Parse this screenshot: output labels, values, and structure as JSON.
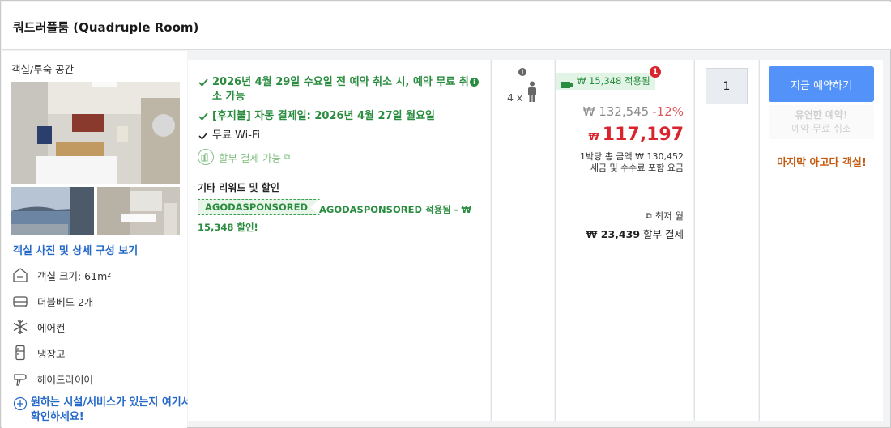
{
  "header": {
    "title": "쿼드러플룸 (Quadruple Room)"
  },
  "left": {
    "section_title": "객실/투숙 공간",
    "view_link": "객실 사진 및 상세 구성 보기",
    "amenities": [
      {
        "icon": "room-size-icon",
        "label": "객실 크기: 61m²"
      },
      {
        "icon": "bed-icon",
        "label": "더블베드 2개"
      },
      {
        "icon": "snowflake-icon",
        "label": "에어컨"
      },
      {
        "icon": "fridge-icon",
        "label": "냉장고"
      },
      {
        "icon": "hairdryer-icon",
        "label": "헤어드라이어"
      }
    ],
    "more_link": "원하는 시설/서비스가 있는지 여기서 확인하세요!"
  },
  "benefits": {
    "cancel": "2026년 4월 29일 수요일 전 예약 취소 시, 예약 무료 취소 가능",
    "postpay": "[후지불] 자동 결제일: 2026년 4월 27일 월요일",
    "wifi": "무료 Wi-Fi",
    "installment": "할부 결제 가능",
    "other_title": "기타 리워드 및 할인",
    "promo_code": "AGODASPONSORED",
    "promo_text": "AGODASPONSORED 적용됨 - ₩ 15,348 할인!"
  },
  "occupancy": {
    "count": "4 x"
  },
  "price": {
    "savings": "₩ 15,348 적용됨",
    "badge": "1",
    "original": "₩ 132,545",
    "discount": "-12%",
    "currency": "₩",
    "amount": "117,197",
    "total_line1": "1박당 총 금액 ₩ 130,452",
    "total_line2": "세금 및 수수료 포함 요금",
    "lowest_label": "최저 월",
    "monthly_amount": "₩ 23,439",
    "monthly_suffix": "할부 결제"
  },
  "quantity": {
    "value": "1"
  },
  "booking": {
    "button": "지금 예약하기",
    "flex_title": "유연한 예약!",
    "flex_sub": "예약 무료 취소",
    "last_room": "마지막 아고다 객실!"
  },
  "colors": {
    "accent": "#5392f9",
    "green": "#2a8c3f",
    "red": "#d9232d",
    "link": "#2468c8"
  }
}
